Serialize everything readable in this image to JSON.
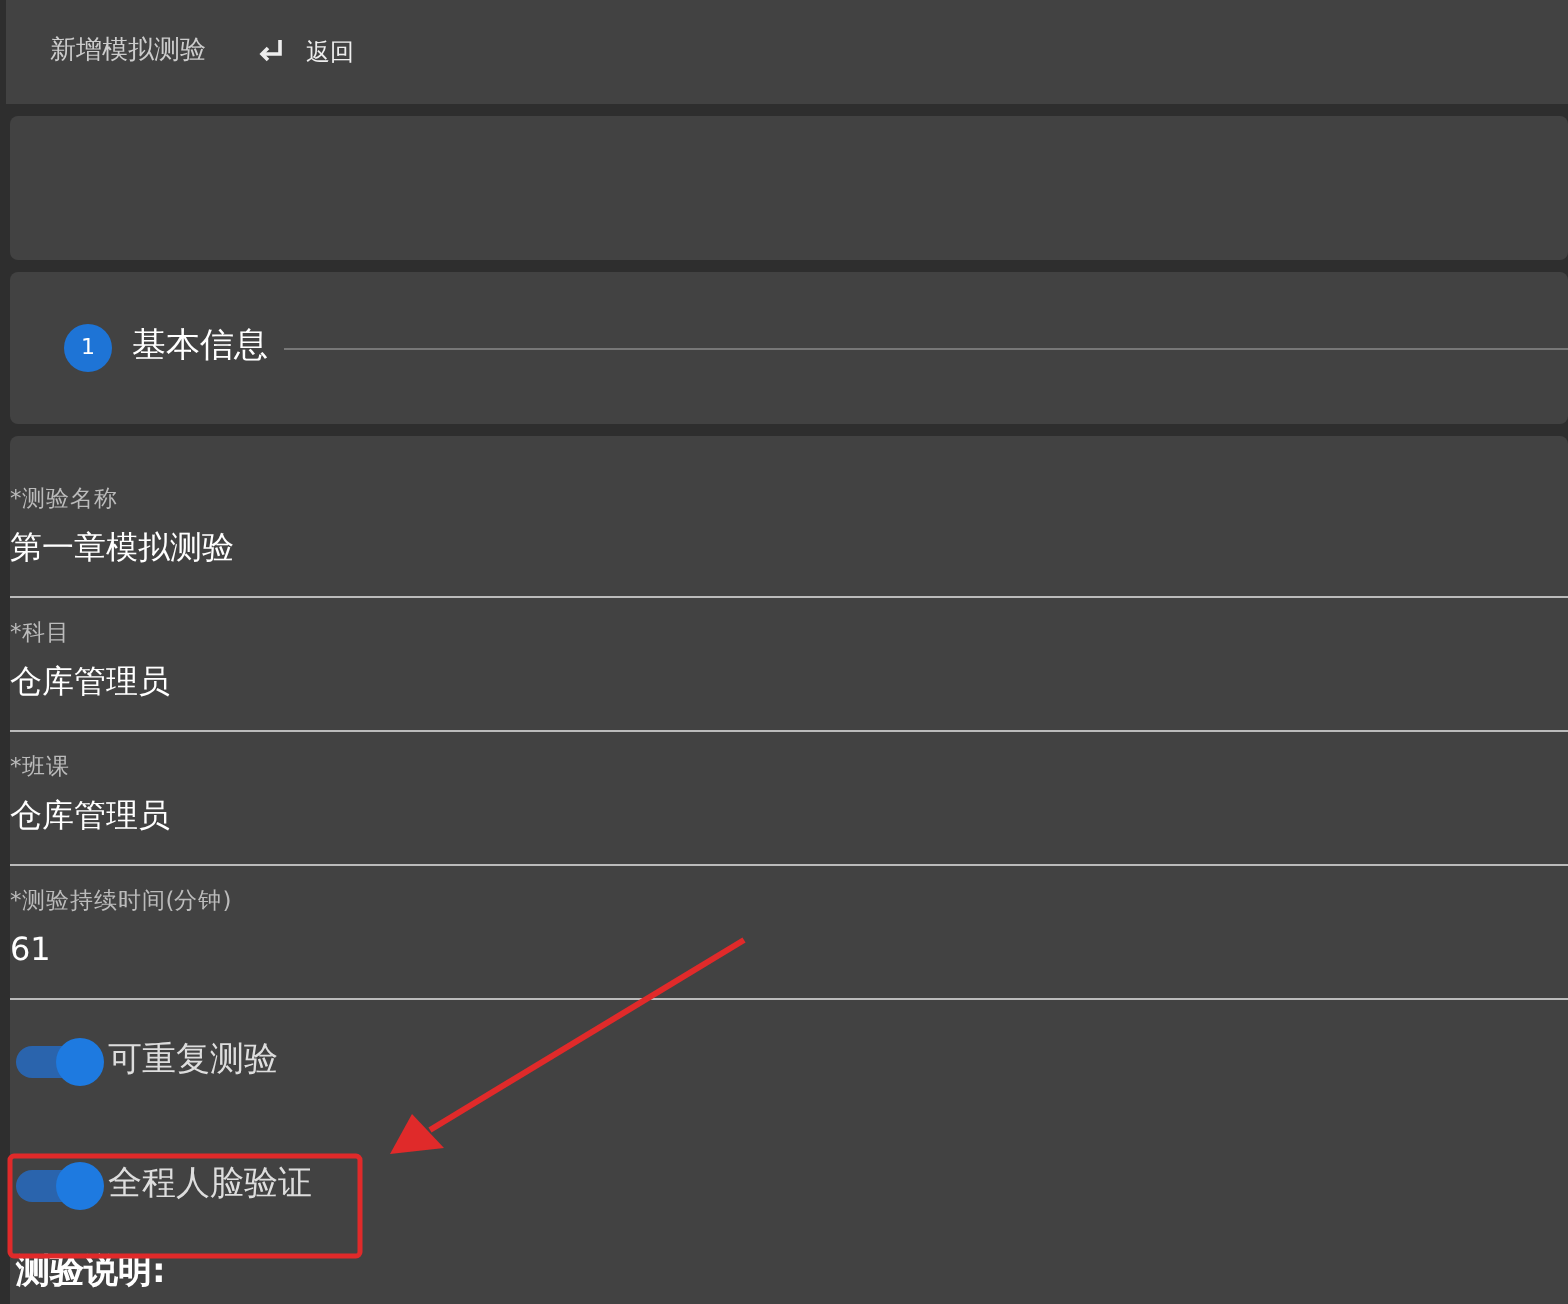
{
  "header": {
    "title": "新增模拟测验",
    "back_label": "返回"
  },
  "step": {
    "number": "1",
    "title": "基本信息"
  },
  "fields": [
    {
      "label": "*测验名称",
      "value": "第一章模拟测验"
    },
    {
      "label": "*科目",
      "value": "仓库管理员"
    },
    {
      "label": "*班课",
      "value": "仓库管理员"
    },
    {
      "label": "*测验持续时间(分钟)",
      "value": "61"
    }
  ],
  "switches": [
    {
      "label": "可重复测验",
      "on": true
    },
    {
      "label": "全程人脸验证",
      "on": true
    }
  ],
  "description_label": "测验说明:"
}
